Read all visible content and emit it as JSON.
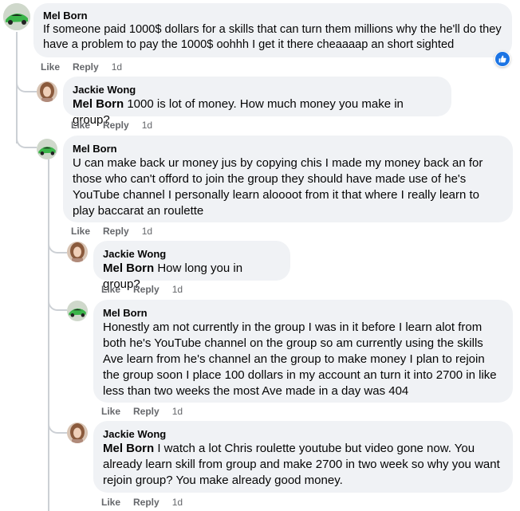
{
  "colors": {
    "bubble": "#f0f2f5",
    "meta": "#65676b",
    "like_blue": "#1b74e4",
    "thread_line": "#ccd0d5"
  },
  "comments": [
    {
      "author": "Mel Born",
      "text": "If someone paid 1000$ dollars for a skills that can turn them millions why the he'll do they have a problem to pay the 1000$ oohhh I get it there cheaaaap an short sighted",
      "like": "Like",
      "reply": "Reply",
      "time": "1d",
      "avatar": "green-car-avatar",
      "reaction": "like-icon"
    },
    {
      "author": "Jackie Wong",
      "mention": "Mel Born",
      "text": " 1000 is lot of money. How much money you make in group?",
      "like": "Like",
      "reply": "Reply",
      "time": "1d",
      "avatar": "woman-photo-avatar"
    },
    {
      "author": "Mel Born",
      "text": "U can make back ur money jus by copying chis I made my money back an for those who can't offord to join the group they should have made use of he's YouTube channel I personally learn aloooot from it that where I really learn to play baccarat an roulette",
      "like": "Like",
      "reply": "Reply",
      "time": "1d",
      "avatar": "green-car-avatar"
    },
    {
      "author": "Jackie Wong",
      "mention": "Mel Born",
      "text": " How long you in group?",
      "like": "Like",
      "reply": "Reply",
      "time": "1d",
      "avatar": "woman-photo-avatar"
    },
    {
      "author": "Mel Born",
      "text": "Honestly am not currently in the group I was in it before I learn alot from both he's YouTube channel on the group so am currently using the skills Ave learn from he's channel an the group to make money I plan to rejoin the group soon I place 100 dollars in my account an turn it into 2700 in like less than two weeks the most Ave made in a day was 404",
      "like": "Like",
      "reply": "Reply",
      "time": "1d",
      "avatar": "green-car-avatar"
    },
    {
      "author": "Jackie Wong",
      "mention": "Mel Born",
      "text": " I watch a lot Chris roulette youtube but video gone now. You already learn skill from group and make 2700 in two week so why you want rejoin group? You make already good money.",
      "like": "Like",
      "reply": "Reply",
      "time": "1d",
      "avatar": "woman-photo-avatar"
    }
  ]
}
